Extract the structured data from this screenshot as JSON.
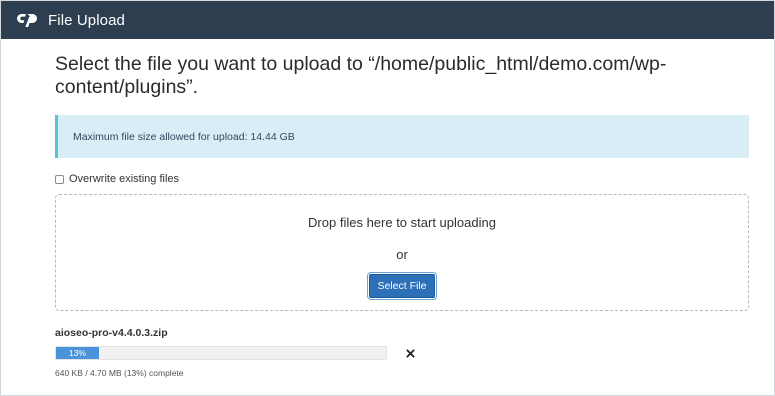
{
  "window": {
    "title": "File Upload",
    "logo_icon": "cpanel-logo-icon"
  },
  "heading": "Select the file you want to upload to “/home/public_html/demo.com/wp-content/plugins”.",
  "info": {
    "message": "Maximum file size allowed for upload: 14.44 GB"
  },
  "options": {
    "overwrite_label": "Overwrite existing files",
    "overwrite_checked": false
  },
  "dropzone": {
    "prompt": "Drop files here to start uploading",
    "or_text": "or",
    "select_button": "Select File"
  },
  "upload": {
    "filename": "aioseo-pro-v4.4.0.3.zip",
    "progress_percent": 13,
    "progress_label": "13%",
    "status": "640 KB / 4.70 MB (13%) complete",
    "cancel_icon": "close-icon"
  },
  "colors": {
    "titlebar": "#2d3e50",
    "info_background": "#d9edf7",
    "button": "#2d70b8",
    "progress": "#4b93d9"
  }
}
